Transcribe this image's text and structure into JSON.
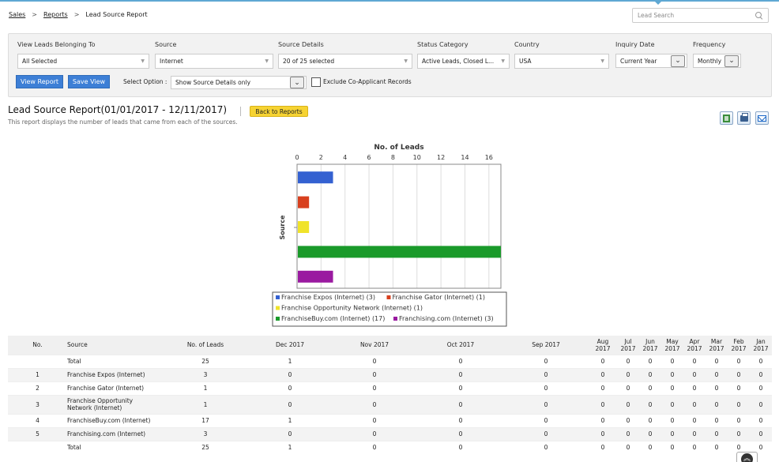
{
  "breadcrumb": {
    "sales": "Sales",
    "reports": "Reports",
    "current": "Lead Source Report",
    "sep": ">"
  },
  "search": {
    "placeholder": "Lead Search"
  },
  "filters": {
    "view_leads": {
      "label": "View Leads Belonging To",
      "value": "All Selected"
    },
    "source": {
      "label": "Source",
      "value": "Internet"
    },
    "source_details": {
      "label": "Source Details",
      "value": "20 of 25 selected"
    },
    "status_category": {
      "label": "Status Category",
      "value": "Active Leads, Closed L..."
    },
    "country": {
      "label": "Country",
      "value": "USA"
    },
    "inquiry_date": {
      "label": "Inquiry Date",
      "value": "Current Year"
    },
    "frequency": {
      "label": "Frequency",
      "value": "Monthly"
    },
    "view_report_btn": "View Report",
    "save_view_btn": "Save View",
    "select_option_label": "Select Option :",
    "select_option_value": "Show Source Details only",
    "exclude_label": "Exclude Co-Applicant Records"
  },
  "report": {
    "title": "Lead Source Report(01/01/2017 - 12/11/2017)",
    "back_btn": "Back to Reports",
    "description": "This report displays the number of leads that came from each of the sources."
  },
  "tools": {
    "excel": "excel-export-icon",
    "print": "print-icon",
    "email": "email-icon"
  },
  "chart_data": {
    "type": "bar",
    "orientation": "horizontal",
    "title": "No. of Leads",
    "ylabel": "Source",
    "xlim": [
      0,
      17
    ],
    "ticks": [
      0,
      2,
      4,
      6,
      8,
      10,
      12,
      14,
      16
    ],
    "series": [
      {
        "name": "Franchise Expos (Internet) (3)",
        "value": 3,
        "color": "#3461d1"
      },
      {
        "name": "Franchise Gator (Internet) (1)",
        "value": 1,
        "color": "#d8401e"
      },
      {
        "name": "Franchise Opportunity Network (Internet) (1)",
        "value": 1,
        "color": "#f0e32a"
      },
      {
        "name": "FranchiseBuy.com (Internet) (17)",
        "value": 17,
        "color": "#1a9a2a"
      },
      {
        "name": "Franchising.com (Internet) (3)",
        "value": 3,
        "color": "#9a1aa0"
      }
    ]
  },
  "table": {
    "headers": [
      "No.",
      "Source",
      "No. of Leads",
      "Dec 2017",
      "Nov 2017",
      "Oct 2017",
      "Sep 2017",
      "Aug 2017",
      "Jul 2017",
      "Jun 2017",
      "May 2017",
      "Apr 2017",
      "Mar 2017",
      "Feb 2017",
      "Jan 2017"
    ],
    "rows": [
      [
        "",
        "Total",
        "25",
        "1",
        "0",
        "0",
        "0",
        "0",
        "0",
        "0",
        "0",
        "0",
        "0",
        "0",
        "0"
      ],
      [
        "1",
        "Franchise Expos (Internet)",
        "3",
        "0",
        "0",
        "0",
        "0",
        "0",
        "0",
        "0",
        "0",
        "0",
        "0",
        "0",
        "0"
      ],
      [
        "2",
        "Franchise Gator (Internet)",
        "1",
        "0",
        "0",
        "0",
        "0",
        "0",
        "0",
        "0",
        "0",
        "0",
        "0",
        "0",
        "0"
      ],
      [
        "3",
        "Franchise Opportunity Network (Internet)",
        "1",
        "0",
        "0",
        "0",
        "0",
        "0",
        "0",
        "0",
        "0",
        "0",
        "0",
        "0",
        "0"
      ],
      [
        "4",
        "FranchiseBuy.com (Internet)",
        "17",
        "1",
        "0",
        "0",
        "0",
        "0",
        "0",
        "0",
        "0",
        "0",
        "0",
        "0",
        "0"
      ],
      [
        "5",
        "Franchising.com (Internet)",
        "3",
        "0",
        "0",
        "0",
        "0",
        "0",
        "0",
        "0",
        "0",
        "0",
        "0",
        "0",
        "0"
      ],
      [
        "",
        "Total",
        "25",
        "1",
        "0",
        "0",
        "0",
        "0",
        "0",
        "0",
        "0",
        "0",
        "0",
        "0",
        "0"
      ]
    ]
  }
}
